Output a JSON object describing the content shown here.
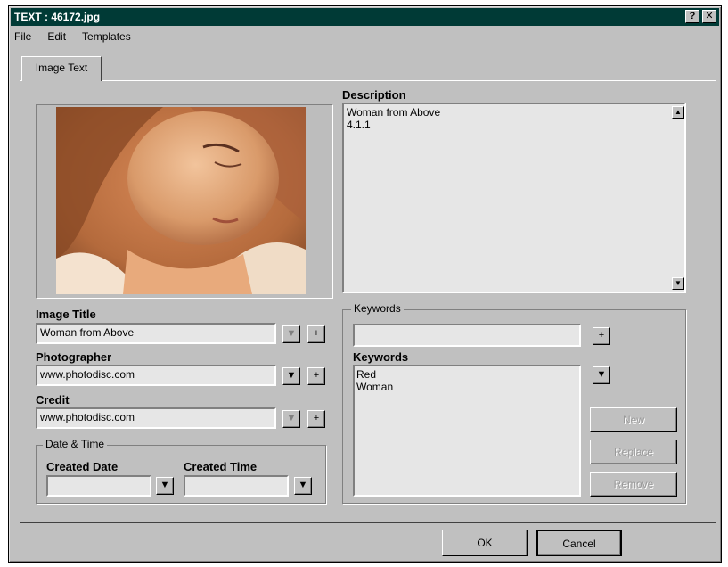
{
  "window": {
    "title": "TEXT : 46172.jpg",
    "help_button": "?",
    "close_button": "✕"
  },
  "menu": [
    "File",
    "Edit",
    "Templates"
  ],
  "tab": {
    "label": "Image Text"
  },
  "left": {
    "image_title": {
      "label": "Image Title",
      "value": "Woman from Above"
    },
    "photographer": {
      "label": "Photographer",
      "value": "www.photodisc.com"
    },
    "credit": {
      "label": "Credit",
      "value": "www.photodisc.com"
    },
    "datetime": {
      "group_label": "Date & Time",
      "created_date_label": "Created Date",
      "created_date_value": "",
      "created_time_label": "Created Time",
      "created_time_value": ""
    },
    "dropdown_glyph": "▼",
    "add_glyph": "+"
  },
  "right": {
    "description": {
      "label": "Description",
      "value": "Woman from Above\n4.1.1"
    },
    "keywords_group": {
      "group_label": "Keywords",
      "entry_value": "",
      "list_label": "Keywords",
      "items": [
        "Red",
        "Woman"
      ],
      "new_label": "New",
      "replace_label": "Replace",
      "remove_label": "Remove"
    }
  },
  "footer": {
    "ok_label": "OK",
    "cancel_label": "Cancel"
  },
  "colors": {
    "titlebar": "#003a36",
    "face": "#c0c0c0"
  }
}
